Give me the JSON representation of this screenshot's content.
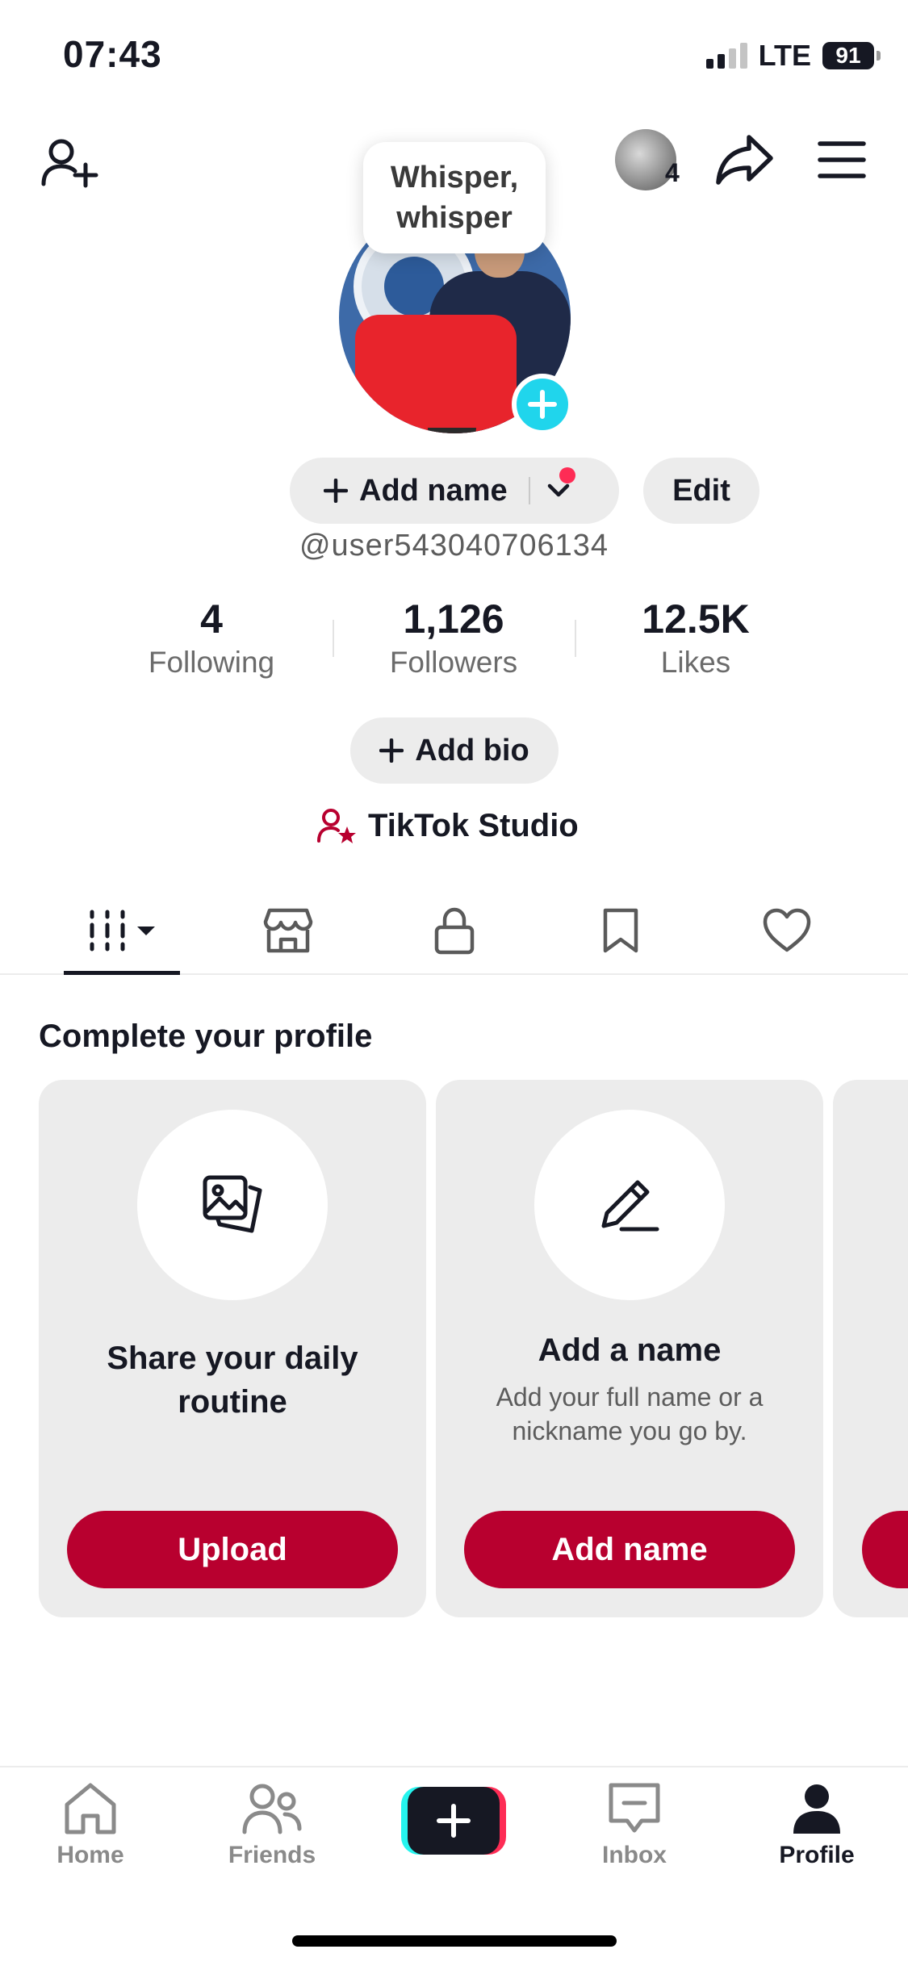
{
  "status_bar": {
    "time": "07:43",
    "network": "LTE",
    "battery": "91"
  },
  "header": {
    "notification_count": "4"
  },
  "tooltip": {
    "text": "Whisper, whisper"
  },
  "profile": {
    "add_name_label": "Add name",
    "edit_label": "Edit",
    "username": "@user543040706134"
  },
  "stats": [
    {
      "value": "4",
      "label": "Following"
    },
    {
      "value": "1,126",
      "label": "Followers"
    },
    {
      "value": "12.5K",
      "label": "Likes"
    }
  ],
  "bio": {
    "add_bio_label": "Add bio"
  },
  "studio": {
    "label": "TikTok Studio"
  },
  "tabs": [
    {
      "name": "videos",
      "icon": "grid-icon",
      "active": true
    },
    {
      "name": "shop",
      "icon": "shop-icon",
      "active": false
    },
    {
      "name": "private",
      "icon": "lock-icon",
      "active": false
    },
    {
      "name": "saved",
      "icon": "bookmark-icon",
      "active": false
    },
    {
      "name": "liked",
      "icon": "heart-icon",
      "active": false
    }
  ],
  "complete_profile": {
    "title": "Complete your profile",
    "cards": [
      {
        "icon": "photos-icon",
        "title": "Share your daily routine",
        "description": "",
        "button": "Upload"
      },
      {
        "icon": "pencil-icon",
        "title": "Add a name",
        "description": "Add your full name or a nickname you go by.",
        "button": "Add name"
      }
    ]
  },
  "bottom_nav": [
    {
      "label": "Home",
      "icon": "home-icon",
      "active": false
    },
    {
      "label": "Friends",
      "icon": "friends-icon",
      "active": false
    },
    {
      "label": "",
      "icon": "create-icon",
      "active": false
    },
    {
      "label": "Inbox",
      "icon": "inbox-icon",
      "active": false
    },
    {
      "label": "Profile",
      "icon": "profile-icon",
      "active": true
    }
  ],
  "colors": {
    "accent": "#b8002f",
    "cyan": "#20d5ec",
    "pink": "#fe2c55",
    "text": "#161823",
    "pill": "#ececec"
  }
}
